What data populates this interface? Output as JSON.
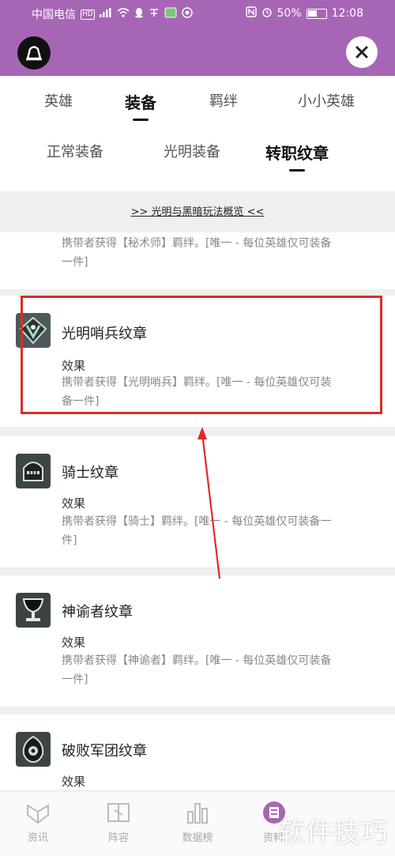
{
  "status_bar": {
    "carrier": "中国电信",
    "hd": "HD",
    "battery": "50%",
    "time": "12:08"
  },
  "tabs_main": [
    {
      "label": "英雄",
      "active": false
    },
    {
      "label": "装备",
      "active": true
    },
    {
      "label": "羁绊",
      "active": false
    },
    {
      "label": "小小英雄",
      "active": false
    }
  ],
  "tabs_sub": [
    {
      "label": "正常装备",
      "active": false
    },
    {
      "label": "光明装备",
      "active": false
    },
    {
      "label": "转职纹章",
      "active": true
    }
  ],
  "overview_link": ">> 光明与黑暗玩法概览 <<",
  "items": [
    {
      "desc": "携带者获得【秘术师】羁绊。[唯一 - 每位英雄仅可装备一件]",
      "desc_line1": "携带者获得【秘术师】羁绊。[唯一 - 每位英雄仅可装备",
      "desc_line2": "一件]"
    },
    {
      "name": "光明哨兵纹章",
      "effect_label": "效果",
      "desc_line1": "携带者获得【光明哨兵】羁绊。[唯一 - 每位英雄仅可装",
      "desc_line2": "备一件]",
      "icon": "sentinel-emblem-icon"
    },
    {
      "name": "骑士纹章",
      "effect_label": "效果",
      "desc_line1": "携带者获得【骑士】羁绊。[唯一 - 每位英雄仅可装备一",
      "desc_line2": "件]",
      "icon": "knight-helmet-icon"
    },
    {
      "name": "神谕者纹章",
      "effect_label": "效果",
      "desc_line1": "携带者获得【神谕者】羁绊。[唯一 - 每位英雄仅可装备",
      "desc_line2": "一件]",
      "icon": "chalice-icon"
    },
    {
      "name": "破败军团纹章",
      "effect_label": "效果",
      "icon": "ruined-legion-icon"
    }
  ],
  "bottom_nav": [
    {
      "label": "资讯",
      "icon": "news-icon"
    },
    {
      "label": "阵容",
      "icon": "lineup-book-icon"
    },
    {
      "label": "数据榜",
      "icon": "bar-chart-icon"
    },
    {
      "label": "资料",
      "icon": "data-icon",
      "active": true
    }
  ],
  "watermark": "软件技巧",
  "colors": {
    "header": "#a766b5",
    "highlight": "#e02a2a",
    "annotation_arrow": "#e02a2a"
  }
}
